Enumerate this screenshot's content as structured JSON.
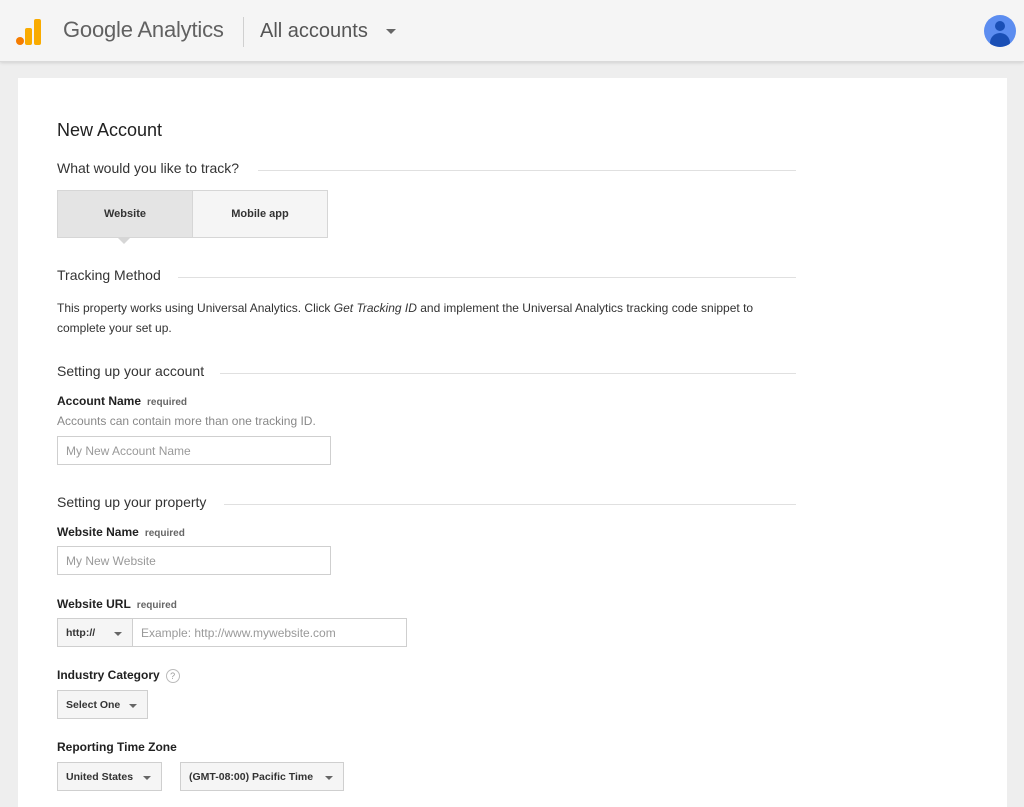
{
  "header": {
    "brand": "Google Analytics",
    "account_selector": "All accounts"
  },
  "form": {
    "title": "New Account",
    "track_section": "What would you like to track?",
    "track_options": [
      "Website",
      "Mobile app"
    ],
    "tracking_method": {
      "heading": "Tracking Method",
      "text_before": "This property works using Universal Analytics. Click ",
      "text_em": "Get Tracking ID",
      "text_after": " and implement the Universal Analytics tracking code snippet to complete your set up."
    },
    "account_section": "Setting up your account",
    "account_name": {
      "label": "Account Name",
      "required": "required",
      "hint": "Accounts can contain more than one tracking ID.",
      "placeholder": "My New Account Name"
    },
    "property_section": "Setting up your property",
    "website_name": {
      "label": "Website Name",
      "required": "required",
      "placeholder": "My New Website"
    },
    "website_url": {
      "label": "Website URL",
      "required": "required",
      "protocol": "http://",
      "placeholder": "Example: http://www.mywebsite.com"
    },
    "industry": {
      "label": "Industry Category",
      "help": "?",
      "selected": "Select One"
    },
    "timezone": {
      "label": "Reporting Time Zone",
      "country": "United States",
      "zone": "(GMT-08:00) Pacific Time"
    }
  }
}
